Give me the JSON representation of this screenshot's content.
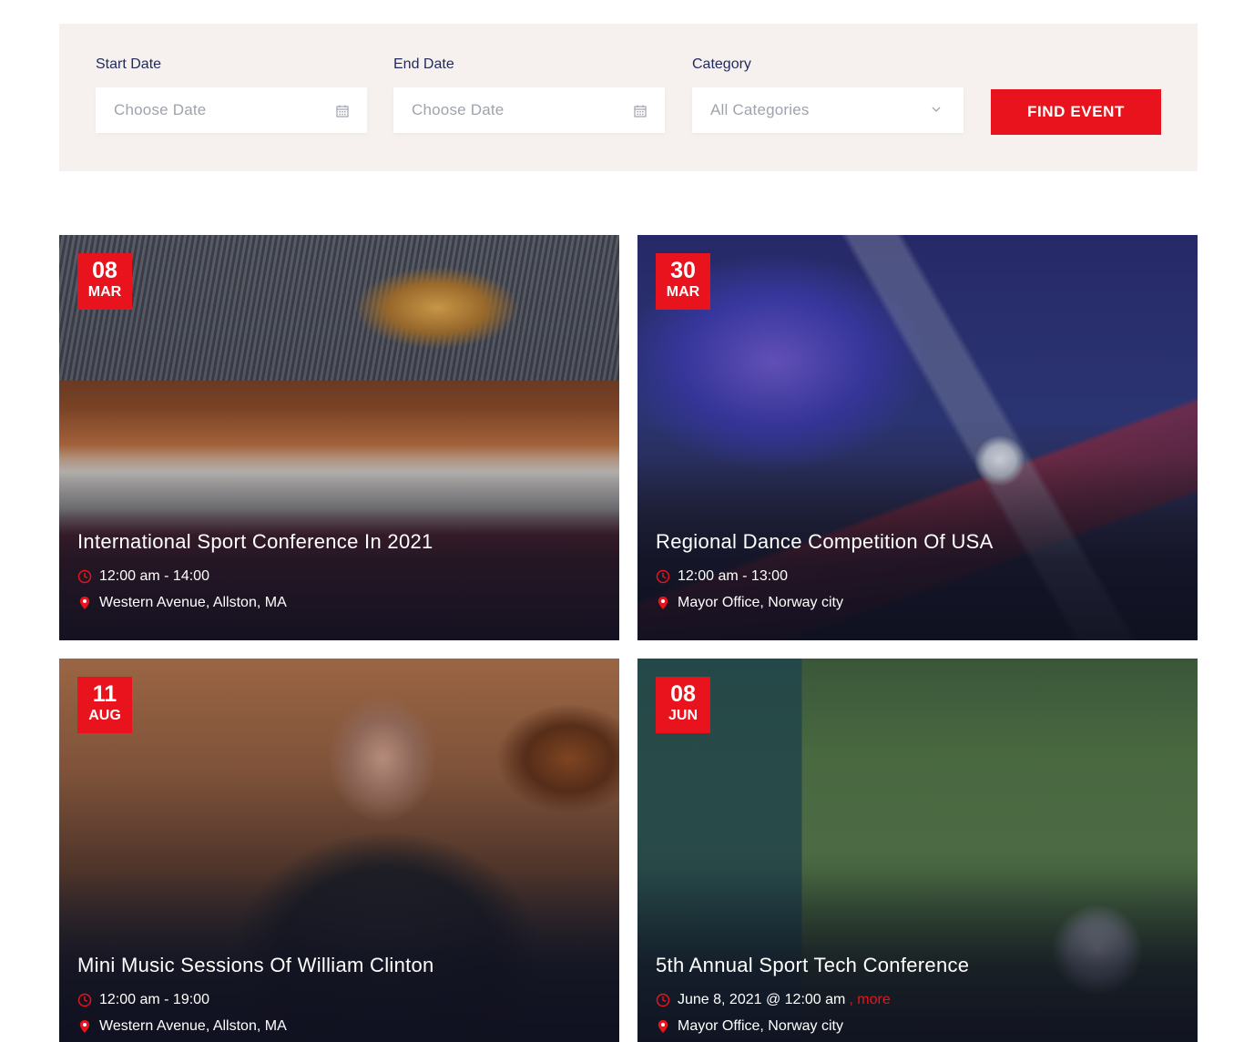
{
  "filters": {
    "start_date": {
      "label": "Start Date",
      "placeholder": "Choose Date"
    },
    "end_date": {
      "label": "End Date",
      "placeholder": "Choose Date"
    },
    "category": {
      "label": "Category",
      "selected": "All Categories"
    },
    "find_button": "FIND EVENT"
  },
  "colors": {
    "accent": "#e8131c",
    "filter_bg": "#f6f1ef",
    "label": "#1f2a5a"
  },
  "events": [
    {
      "day": "08",
      "month": "MAR",
      "title": "International Sport Conference In 2021",
      "time": "12:00 am - 14:00",
      "location": "Western Avenue, Allston, MA"
    },
    {
      "day": "30",
      "month": "MAR",
      "title": "Regional Dance Competition Of USA",
      "time": "12:00 am - 13:00",
      "location": "Mayor Office, Norway city"
    },
    {
      "day": "11",
      "month": "AUG",
      "title": "Mini Music Sessions Of William Clinton",
      "time": "12:00 am - 19:00",
      "location": "Western Avenue, Allston, MA"
    },
    {
      "day": "08",
      "month": "JUN",
      "title": "5th Annual Sport Tech Conference",
      "time": "June 8, 2021 @ 12:00 am",
      "more": ", more",
      "location": "Mayor Office, Norway city"
    }
  ]
}
